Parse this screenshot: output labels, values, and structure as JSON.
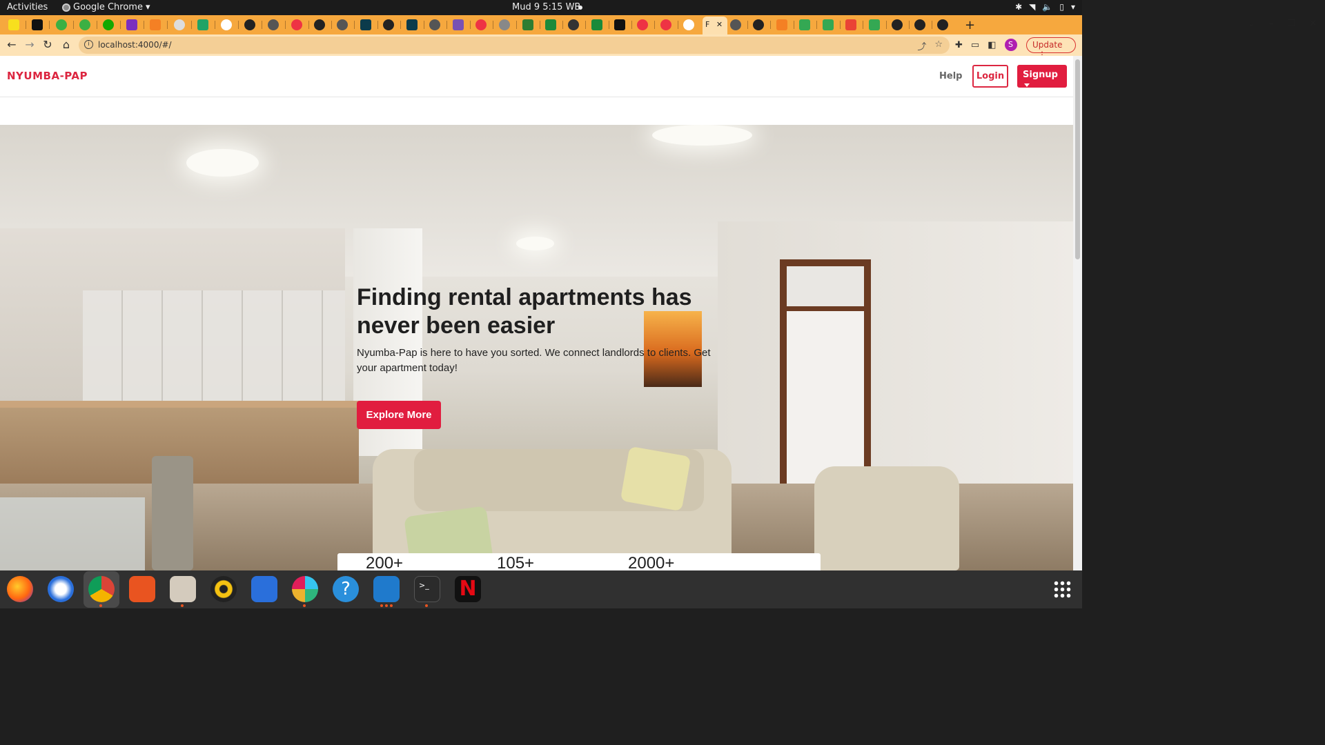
{
  "system": {
    "activities_label": "Activities",
    "app_name": "Google Chrome",
    "clock": "Mud 9  5:15 WB"
  },
  "browser": {
    "active_tab_title": "F",
    "url": "localhost:4000/#/",
    "update_label": "Update",
    "profile_initial": "S"
  },
  "site": {
    "brand": "NYUMBA-PAP",
    "nav": {
      "help": "Help",
      "login": "Login",
      "signup": "Signup"
    },
    "hero": {
      "title": "Finding rental apartments has never been easier",
      "subtitle": "Nyumba-Pap is here to have you sorted. We connect landlords to clients. Get your apartment today!",
      "cta": "Explore More"
    },
    "stats": [
      "200+",
      "105+",
      "2000+"
    ]
  },
  "dock": {
    "apps": [
      "firefox-icon",
      "thunderbird-icon",
      "chrome-icon",
      "software-center-icon",
      "files-icon",
      "rhythmbox-icon",
      "writer-icon",
      "slack-icon",
      "help-icon",
      "vscode-icon",
      "terminal-icon",
      "netflix-icon"
    ]
  },
  "colors": {
    "brand": "#dc2640",
    "primary_button": "#e11d3f",
    "tabstrip": "#f6a83e",
    "toolbar": "#fde3b7"
  }
}
